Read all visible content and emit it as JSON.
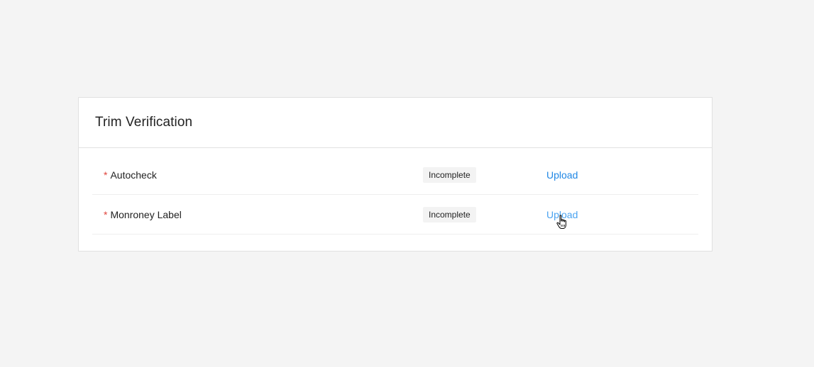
{
  "card": {
    "title": "Trim Verification"
  },
  "rows": [
    {
      "required_mark": "*",
      "label": "Autocheck",
      "status": "Incomplete",
      "action": "Upload"
    },
    {
      "required_mark": "*",
      "label": "Monroney Label",
      "status": "Incomplete",
      "action": "Upload"
    }
  ],
  "colors": {
    "page_background": "#f4f4f4",
    "link": "#1f87e5",
    "required": "#e0443c"
  },
  "icons": {
    "cursor": "hand-pointer-icon"
  }
}
